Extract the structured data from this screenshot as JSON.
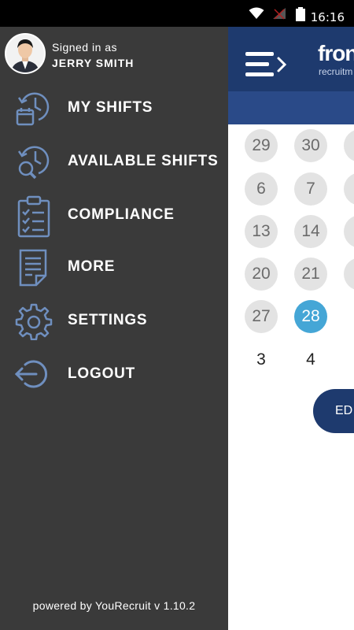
{
  "status_bar": {
    "time": "16:16",
    "icons": [
      "wifi-icon",
      "no-signal-icon",
      "battery-icon"
    ]
  },
  "app": {
    "brand_name": "fron",
    "brand_sub": "recruitm",
    "calendar_days": [
      "29",
      "30",
      "6",
      "7",
      "13",
      "14",
      "20",
      "21",
      "27",
      "28",
      "3",
      "4"
    ],
    "selected_day": "28",
    "edit_button": "ED",
    "colors": {
      "header": "#1e3a6e",
      "selected_day": "#45a6d6"
    }
  },
  "drawer": {
    "signed_in_label": "Signed in as",
    "user_name": "JERRY SMITH",
    "items": [
      {
        "label": "MY SHIFTS",
        "icon": "clock-calendar-icon"
      },
      {
        "label": "AVAILABLE SHIFTS",
        "icon": "clock-search-icon"
      },
      {
        "label": "COMPLIANCE",
        "icon": "clipboard-checklist-icon"
      },
      {
        "label": "MORE",
        "icon": "document-icon"
      },
      {
        "label": "SETTINGS",
        "icon": "gear-icon"
      },
      {
        "label": "LOGOUT",
        "icon": "logout-icon"
      }
    ],
    "powered_by": "powered by YouRecruit v 1.10.2",
    "colors": {
      "background": "#3a3a3a",
      "icon": "#6f8fbf"
    }
  }
}
